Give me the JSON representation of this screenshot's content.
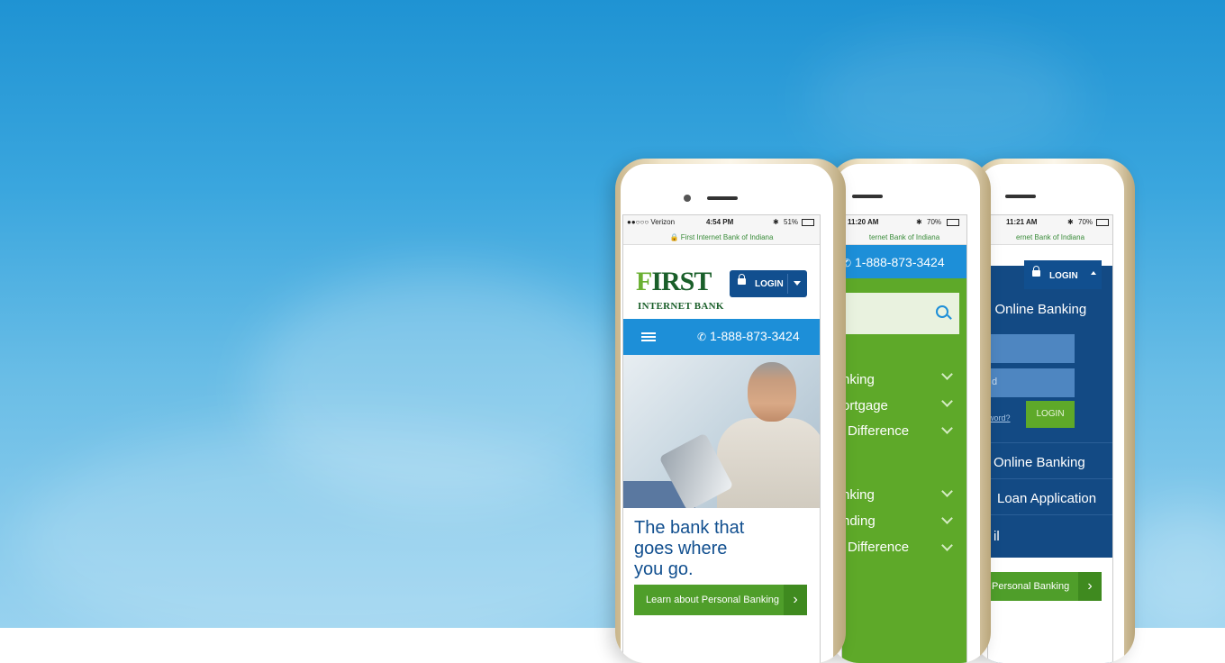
{
  "phone1": {
    "carrier": "●●○○○ Verizon",
    "time": "4:54 PM",
    "battery": "51%",
    "url": "🔒 First Internet Bank of Indiana",
    "logo_main": "FIRST",
    "logo_sub": "INTERNET BANK",
    "login_label": "LOGIN",
    "phone_number": "1-888-873-3424",
    "tagline_1": "The bank that",
    "tagline_2": "goes where",
    "tagline_3": "you go.",
    "cta_label": "Learn about Personal Banking"
  },
  "phone2": {
    "time": "11:20 AM",
    "battery": "70%",
    "url": "ternet Bank of Indiana",
    "phone_number": "1-888-873-3424",
    "menu_items": [
      "nking",
      "ortgage",
      "Difference",
      "nking",
      "nding",
      "Difference"
    ]
  },
  "phone3": {
    "time": "11:21 AM",
    "battery": "70%",
    "url": "ernet Bank of Indiana",
    "logo_fragment": "T",
    "login_label": "LOGIN",
    "panel_title": "l Online Banking",
    "password_placeholder": "d",
    "forgot_link": "word?",
    "login_button": "LOGIN",
    "links": [
      "Online Banking",
      "Loan Application",
      "il"
    ],
    "cta_label": "Personal Banking"
  }
}
